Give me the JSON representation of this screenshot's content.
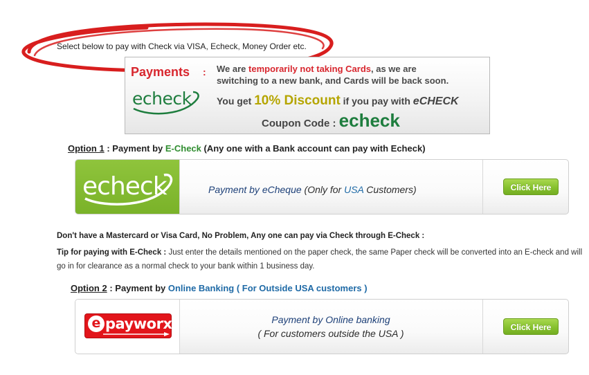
{
  "intro": {
    "text": "Select below to pay with Check via VISA, Echeck, Money Order etc."
  },
  "banner": {
    "title": "Payments",
    "colon": ":",
    "line1_pre": "We are ",
    "line1_red": "temporarily not taking Cards",
    "line1_post": ", as we are",
    "line2": "switching to a new bank, and Cards will be back soon.",
    "logo_text": "echeck",
    "discount_pre": "You get ",
    "discount_pct": "10% Discount",
    "discount_mid": " if you pay with ",
    "discount_brand": "eCHECK",
    "coupon_label": "Coupon Code : ",
    "coupon_code": "echeck"
  },
  "option1": {
    "label": "Option 1",
    "colon_text": " : Payment by ",
    "method": "E-Check",
    "rest": " (Any one with a Bank account can pay with Echeck)",
    "logo_text": "echeck",
    "desc_a": "Payment by eCheque",
    "desc_b": " (Only for ",
    "desc_c": "USA",
    "desc_d": " Customers)",
    "button": "Click Here"
  },
  "notes": {
    "line1": "Don't have a Mastercard or Visa Card, No Problem, Any one can pay via Check through E-Check :",
    "tip_label": "Tip for paying with E-Check :",
    "tip_text": " Just enter the details mentioned on the paper check, the same Paper check will be converted into an E-check and will go in for clearance as a normal check to your bank within 1 business day."
  },
  "option2": {
    "label": "Option 2",
    "colon_text": " : Payment by ",
    "method": "Online Banking ( For Outside USA customers )",
    "logo_e": "e",
    "logo_text": "payworx",
    "desc1": "Payment by Online banking",
    "desc2": "( For customers outside the USA )",
    "button": "Click Here"
  },
  "colors": {
    "accent_red": "#d8262e",
    "echeck_green": "#1e7d3e",
    "button_green": "#86c12e",
    "link_blue": "#1f6aa6",
    "navy": "#1c3f77"
  }
}
